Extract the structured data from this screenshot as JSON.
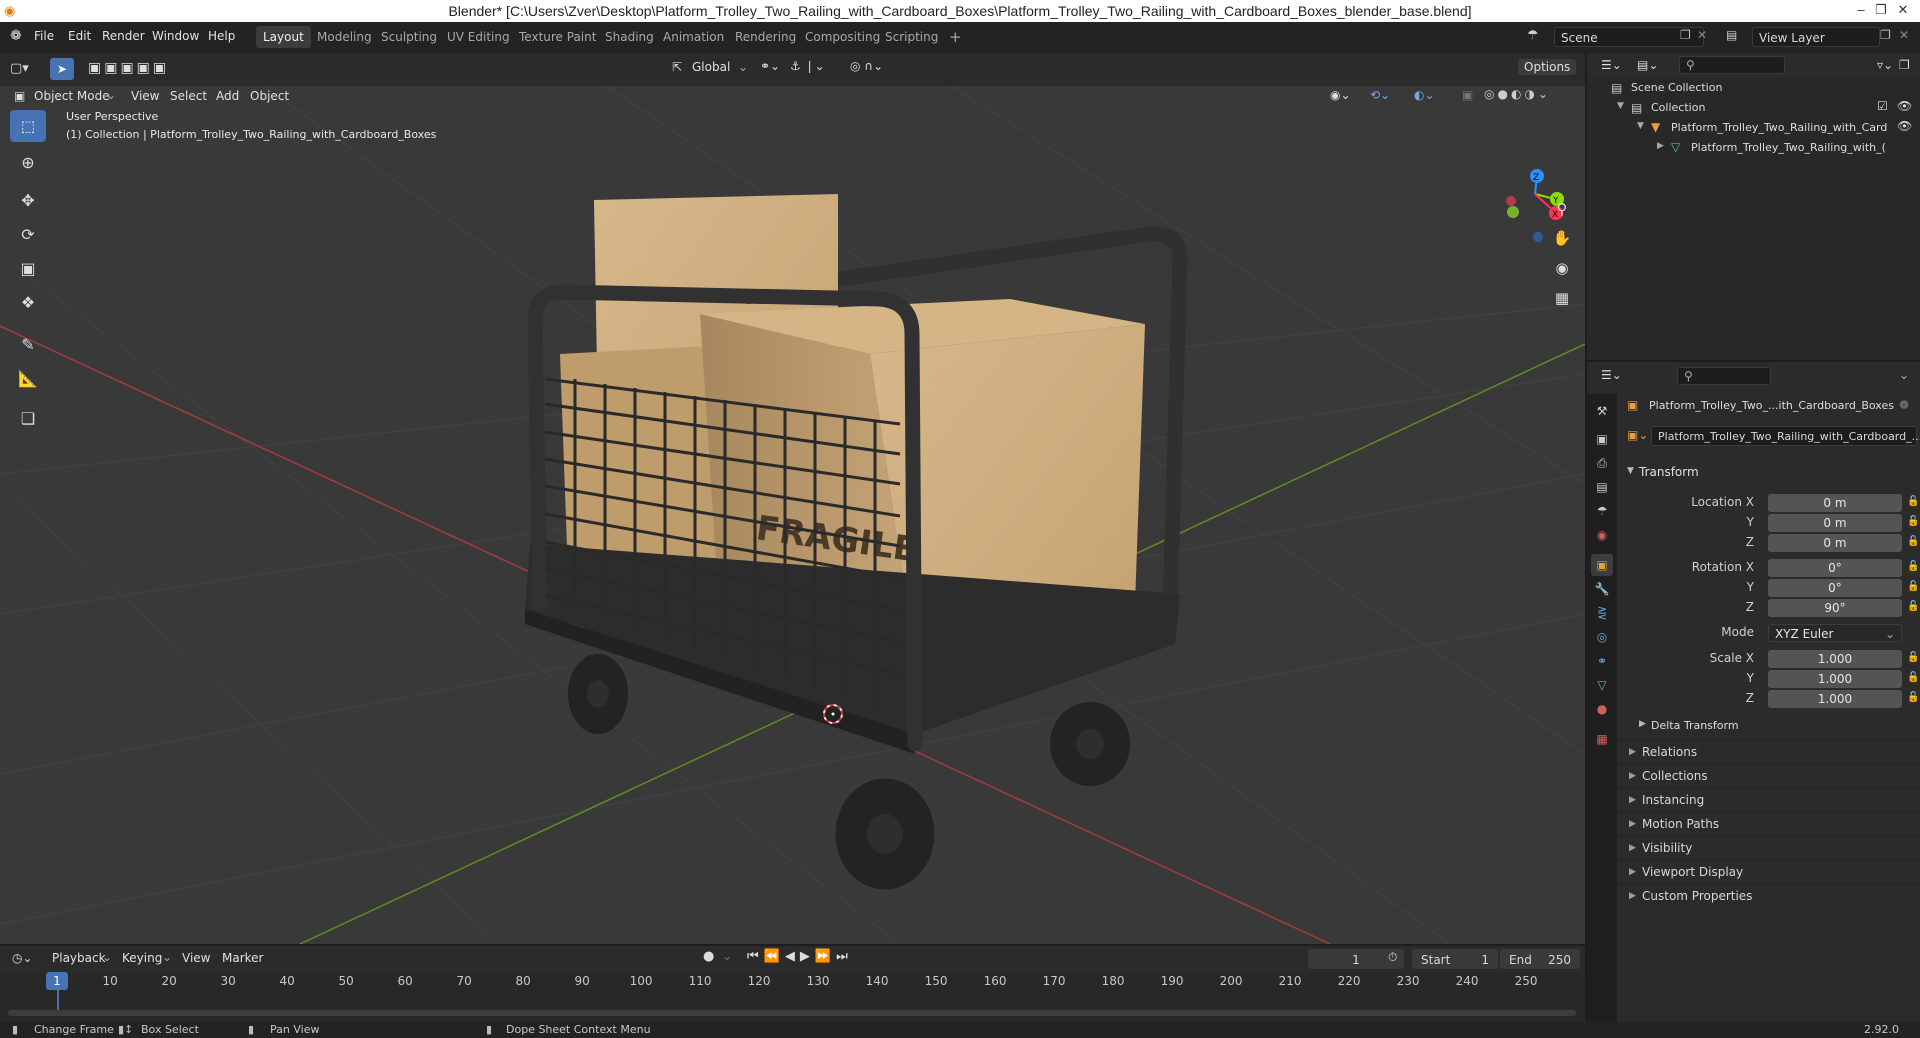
{
  "window": {
    "title": "Blender* [C:\\Users\\Zver\\Desktop\\Platform_Trolley_Two_Railing_with_Cardboard_Boxes\\Platform_Trolley_Two_Railing_with_Cardboard_Boxes_blender_base.blend]",
    "minimize": "–",
    "restore": "❐",
    "close": "✕"
  },
  "menu": [
    "File",
    "Edit",
    "Render",
    "Window",
    "Help"
  ],
  "workspaces": [
    "Layout",
    "Modeling",
    "Sculpting",
    "UV Editing",
    "Texture Paint",
    "Shading",
    "Animation",
    "Rendering",
    "Compositing",
    "Scripting"
  ],
  "workspace_add": "+",
  "scene": {
    "name": "Scene",
    "view_layer": "View Layer"
  },
  "viewport": {
    "mode": "Object Mode",
    "menus": [
      "View",
      "Select",
      "Add",
      "Object"
    ],
    "orientation": "Global",
    "options": "Options",
    "overlay_title": "User Perspective",
    "overlay_subtitle": "(1) Collection | Platform_Trolley_Two_Railing_with_Cardboard_Boxes",
    "gizmo": {
      "x": "X",
      "y": "Y",
      "z": "Z"
    },
    "box_label": "FRAGILE"
  },
  "outliner": {
    "scene_collection": "Scene Collection",
    "collection": "Collection",
    "object": "Platform_Trolley_Two_Railing_with_Card",
    "mesh": "Platform_Trolley_Two_Railing_with_("
  },
  "properties": {
    "object_name": "Platform_Trolley_Two_...ith_Cardboard_Boxes",
    "data_name": "Platform_Trolley_Two_Railing_with_Cardboard_...",
    "transform_header": "Transform",
    "location_x_label": "Location X",
    "location": [
      "0 m",
      "0 m",
      "0 m"
    ],
    "rotation_x_label": "Rotation X",
    "rotation": [
      "0°",
      "0°",
      "90°"
    ],
    "y_label": "Y",
    "z_label": "Z",
    "mode_label": "Mode",
    "mode_value": "XYZ Euler",
    "scale_x_label": "Scale X",
    "scale": [
      "1.000",
      "1.000",
      "1.000"
    ],
    "delta_transform": "Delta Transform",
    "panels": [
      "Relations",
      "Collections",
      "Instancing",
      "Motion Paths",
      "Visibility",
      "Viewport Display",
      "Custom Properties"
    ]
  },
  "timeline": {
    "menus": [
      "Playback",
      "Keying",
      "View",
      "Marker"
    ],
    "current_frame": "1",
    "start_label": "Start",
    "start": "1",
    "end_label": "End",
    "end": "250",
    "ticks": [
      "1",
      "10",
      "20",
      "30",
      "40",
      "50",
      "60",
      "70",
      "80",
      "90",
      "100",
      "110",
      "120",
      "130",
      "140",
      "150",
      "160",
      "170",
      "180",
      "190",
      "200",
      "210",
      "220",
      "230",
      "240",
      "250"
    ]
  },
  "status": {
    "change_frame": "Change Frame",
    "box_select": "Box Select",
    "pan_view": "Pan View",
    "context_menu": "Dope Sheet Context Menu",
    "version": "2.92.0"
  },
  "colors": {
    "accent": "#4772b3",
    "axis_x": "#ff3352",
    "axis_y": "#8bdc00",
    "axis_z": "#2890ff",
    "viewport_bg": "#393939"
  }
}
